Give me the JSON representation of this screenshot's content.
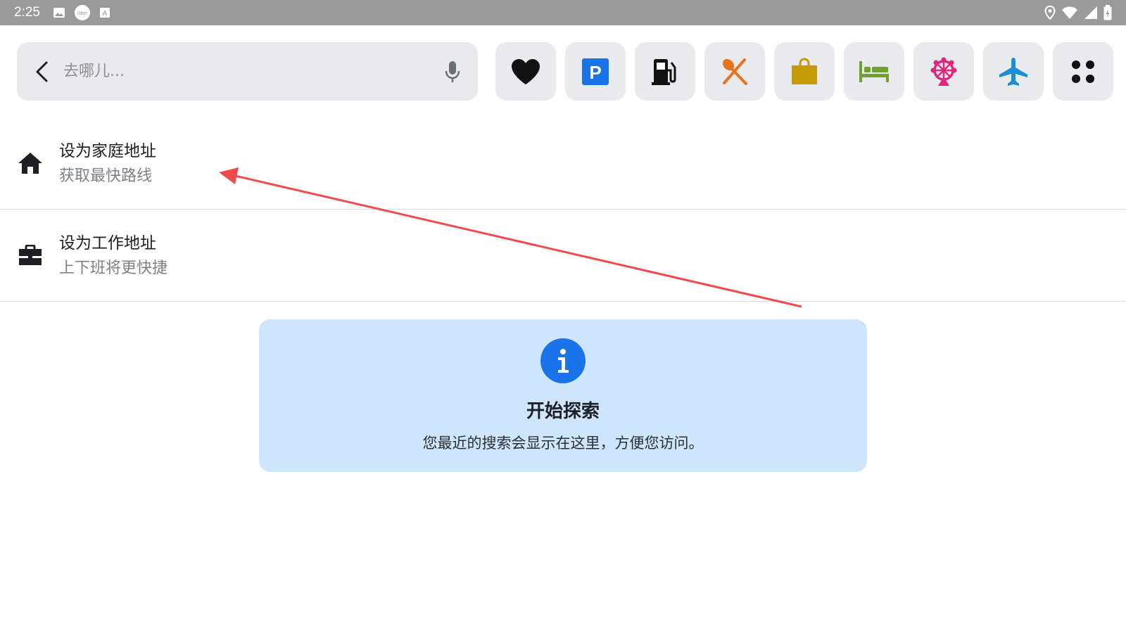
{
  "status_bar": {
    "time": "2:25",
    "left_icons": [
      "image-icon",
      "uber-icon",
      "keyboard-icon"
    ],
    "right_icons": [
      "location-icon",
      "wifi-icon",
      "signal-icon",
      "battery-icon"
    ]
  },
  "search": {
    "placeholder": "去哪儿...",
    "value": ""
  },
  "categories": [
    {
      "name": "favorites",
      "icon": "heart-icon",
      "color": "#111111"
    },
    {
      "name": "parking",
      "icon": "parking-icon",
      "color": "#1a73e8"
    },
    {
      "name": "gas-station",
      "icon": "fuel-icon",
      "color": "#111111"
    },
    {
      "name": "restaurant",
      "icon": "fork-knife-icon",
      "color": "#e6731e"
    },
    {
      "name": "shopping",
      "icon": "shopping-bag-icon",
      "color": "#c49a07"
    },
    {
      "name": "hotel",
      "icon": "bed-icon",
      "color": "#6fa12b"
    },
    {
      "name": "attractions",
      "icon": "ferris-wheel-icon",
      "color": "#e2257a"
    },
    {
      "name": "airport",
      "icon": "airplane-icon",
      "color": "#1a8fd1"
    },
    {
      "name": "more",
      "icon": "more-grid-icon",
      "color": "#111111"
    }
  ],
  "saved_places": {
    "home": {
      "title": "设为家庭地址",
      "subtitle": "获取最快路线",
      "icon": "home-icon"
    },
    "work": {
      "title": "设为工作地址",
      "subtitle": "上下班将更快捷",
      "icon": "briefcase-icon"
    }
  },
  "info_card": {
    "icon": "info-icon",
    "icon_color": "#1a73e8",
    "title": "开始探索",
    "text": "您最近的搜索会显示在这里，方便您访问。"
  },
  "annotation": {
    "type": "arrow",
    "color": "#f04a4a"
  }
}
